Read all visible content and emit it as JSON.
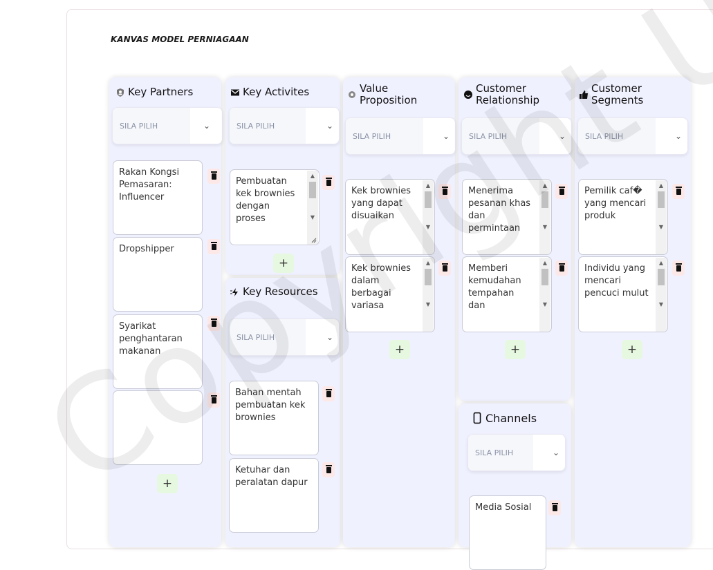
{
  "page": {
    "title": "KANVAS MODEL PERNIAGAAN",
    "watermark": "Copyright UKM"
  },
  "select_placeholder": "SILA PILIH",
  "select_placeholder_clipped": "SILA PILIH",
  "key_partners": {
    "title": "Key Partners",
    "items": [
      "Rakan Kongsi Pemasaran: Influencer",
      "Dropshipper",
      "Syarikat penghantaran makanan",
      ""
    ]
  },
  "key_activities": {
    "title": "Key Activites",
    "items": [
      "Pembuatan kek brownies dengan proses"
    ]
  },
  "key_resources": {
    "title": "Key Resources",
    "items": [
      "Bahan mentah pembuatan kek brownies",
      "Ketuhar dan peralatan dapur"
    ]
  },
  "value_proposition": {
    "title": "Value Proposition",
    "items": [
      "Kek brownies yang dapat disuaikan",
      "Kek brownies dalam berbagai variasa"
    ]
  },
  "customer_relationship": {
    "title": "Customer Relationship",
    "items": [
      "Menerima pesanan khas dan permintaan",
      "Memberi kemudahan tempahan dan"
    ]
  },
  "channels": {
    "title": "Channels",
    "items": [
      "Media Sosial"
    ]
  },
  "customer_segments": {
    "title": "Customer Segments",
    "items": [
      "Pemilik caf� yang mencari produk",
      "Individu yang mencari pencuci mulut"
    ]
  },
  "add_label": "+",
  "colors": {
    "column_bg": "#f0f1ff",
    "delete_bg": "#fde8e8",
    "add_bg": "#e6f8df"
  }
}
